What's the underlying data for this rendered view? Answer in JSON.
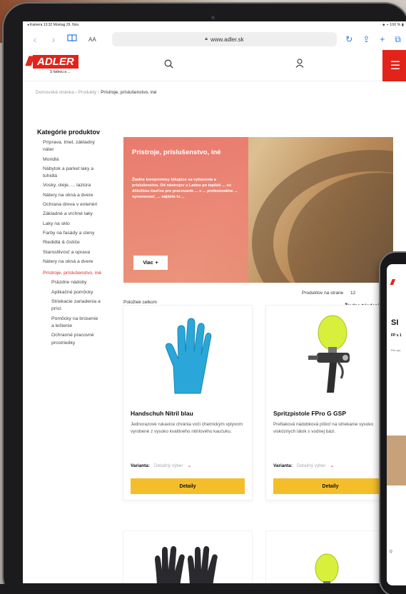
{
  "statusbar": {
    "left": "◂ Kamera  13:32  Montag 29. Nov.",
    "right": "⋅ ◈ ⌁ 100 % ▮"
  },
  "browser": {
    "aa_label": "AA",
    "url": "www.adler.sk"
  },
  "site": {
    "logo_text": "ADLER",
    "logo_tagline": "S farbou a ...",
    "breadcrumb": [
      "Domovská stránka",
      "Produkty",
      "Prístroje, príslušenstvo, iné"
    ]
  },
  "sidebar": {
    "title": "Kategórie produktov",
    "items": [
      "Príprava, tmel, základný náter",
      "Moridlá",
      "Nábytok a parket laky a tuhidlá",
      "Vosky, oleje, ... laziúra",
      "Nátery na okná a dvere",
      "Ochrana dreva v exteriéri",
      "Základné a vrchné laky",
      "Laky na sklo",
      "Farby na fasády a steny",
      "Riedidlá & čističe",
      "Starostlivosť a oprava",
      "Nátery na okná a dvere"
    ],
    "active_item": "Prístroje, príslušenstvo, iné",
    "sub_items": [
      "Prázdne nádoby",
      "Aplikačné pomôcky",
      "Striekacie zariadenia a príst.",
      "Pomôcky na brúsenie a leštenie",
      "Ochranné pracovné prostriedky"
    ]
  },
  "hero": {
    "title": "Prístroje, príslušenstvo, iné",
    "text": "Žiadne kompromisy týkajúce sa vybavenia a príslušenstva. Od nástrojov a Ladou po tapiláti ... sú dôležitou časťou pre pracovanie ... s ... profesionálne ... vynovenosť, ... nájdete tu ...",
    "button_label": "Viac"
  },
  "listing": {
    "total_label": "Položiek celkom",
    "per_page_label": "Produktov na strane",
    "per_page_value": "12",
    "sort_label": "Žiadne triedenie"
  },
  "products": [
    {
      "name": "Handschuh Nitril blau",
      "description": "Jednorazové rukavice chránia voči chemickým vplyvom vyrobené z vysoko kvalitného nitrilového kaučuku.",
      "variant_label": "Varianta:",
      "variant_value": "Detailný výber",
      "button_label": "Detaily"
    },
    {
      "name": "Spritzpistole FPro G GSP",
      "description": "Prefiaková nádobková pištoľ na striekanie vysoko viskóznych látok s vodnej bázi.",
      "variant_label": "Varianta:",
      "variant_value": "Detailný výber",
      "button_label": "Detaily"
    }
  ],
  "phone": {
    "title": "SI",
    "sub": "FP\ns 1",
    "text": "Pre\nsys",
    "bottom": "Ω"
  },
  "colors": {
    "brand_red": "#e2231a",
    "button_yellow": "#f4be2a",
    "hero_overlay": "#ec786e",
    "glove_blue": "#2aa7d8",
    "gun_lime": "#d8f03c"
  }
}
